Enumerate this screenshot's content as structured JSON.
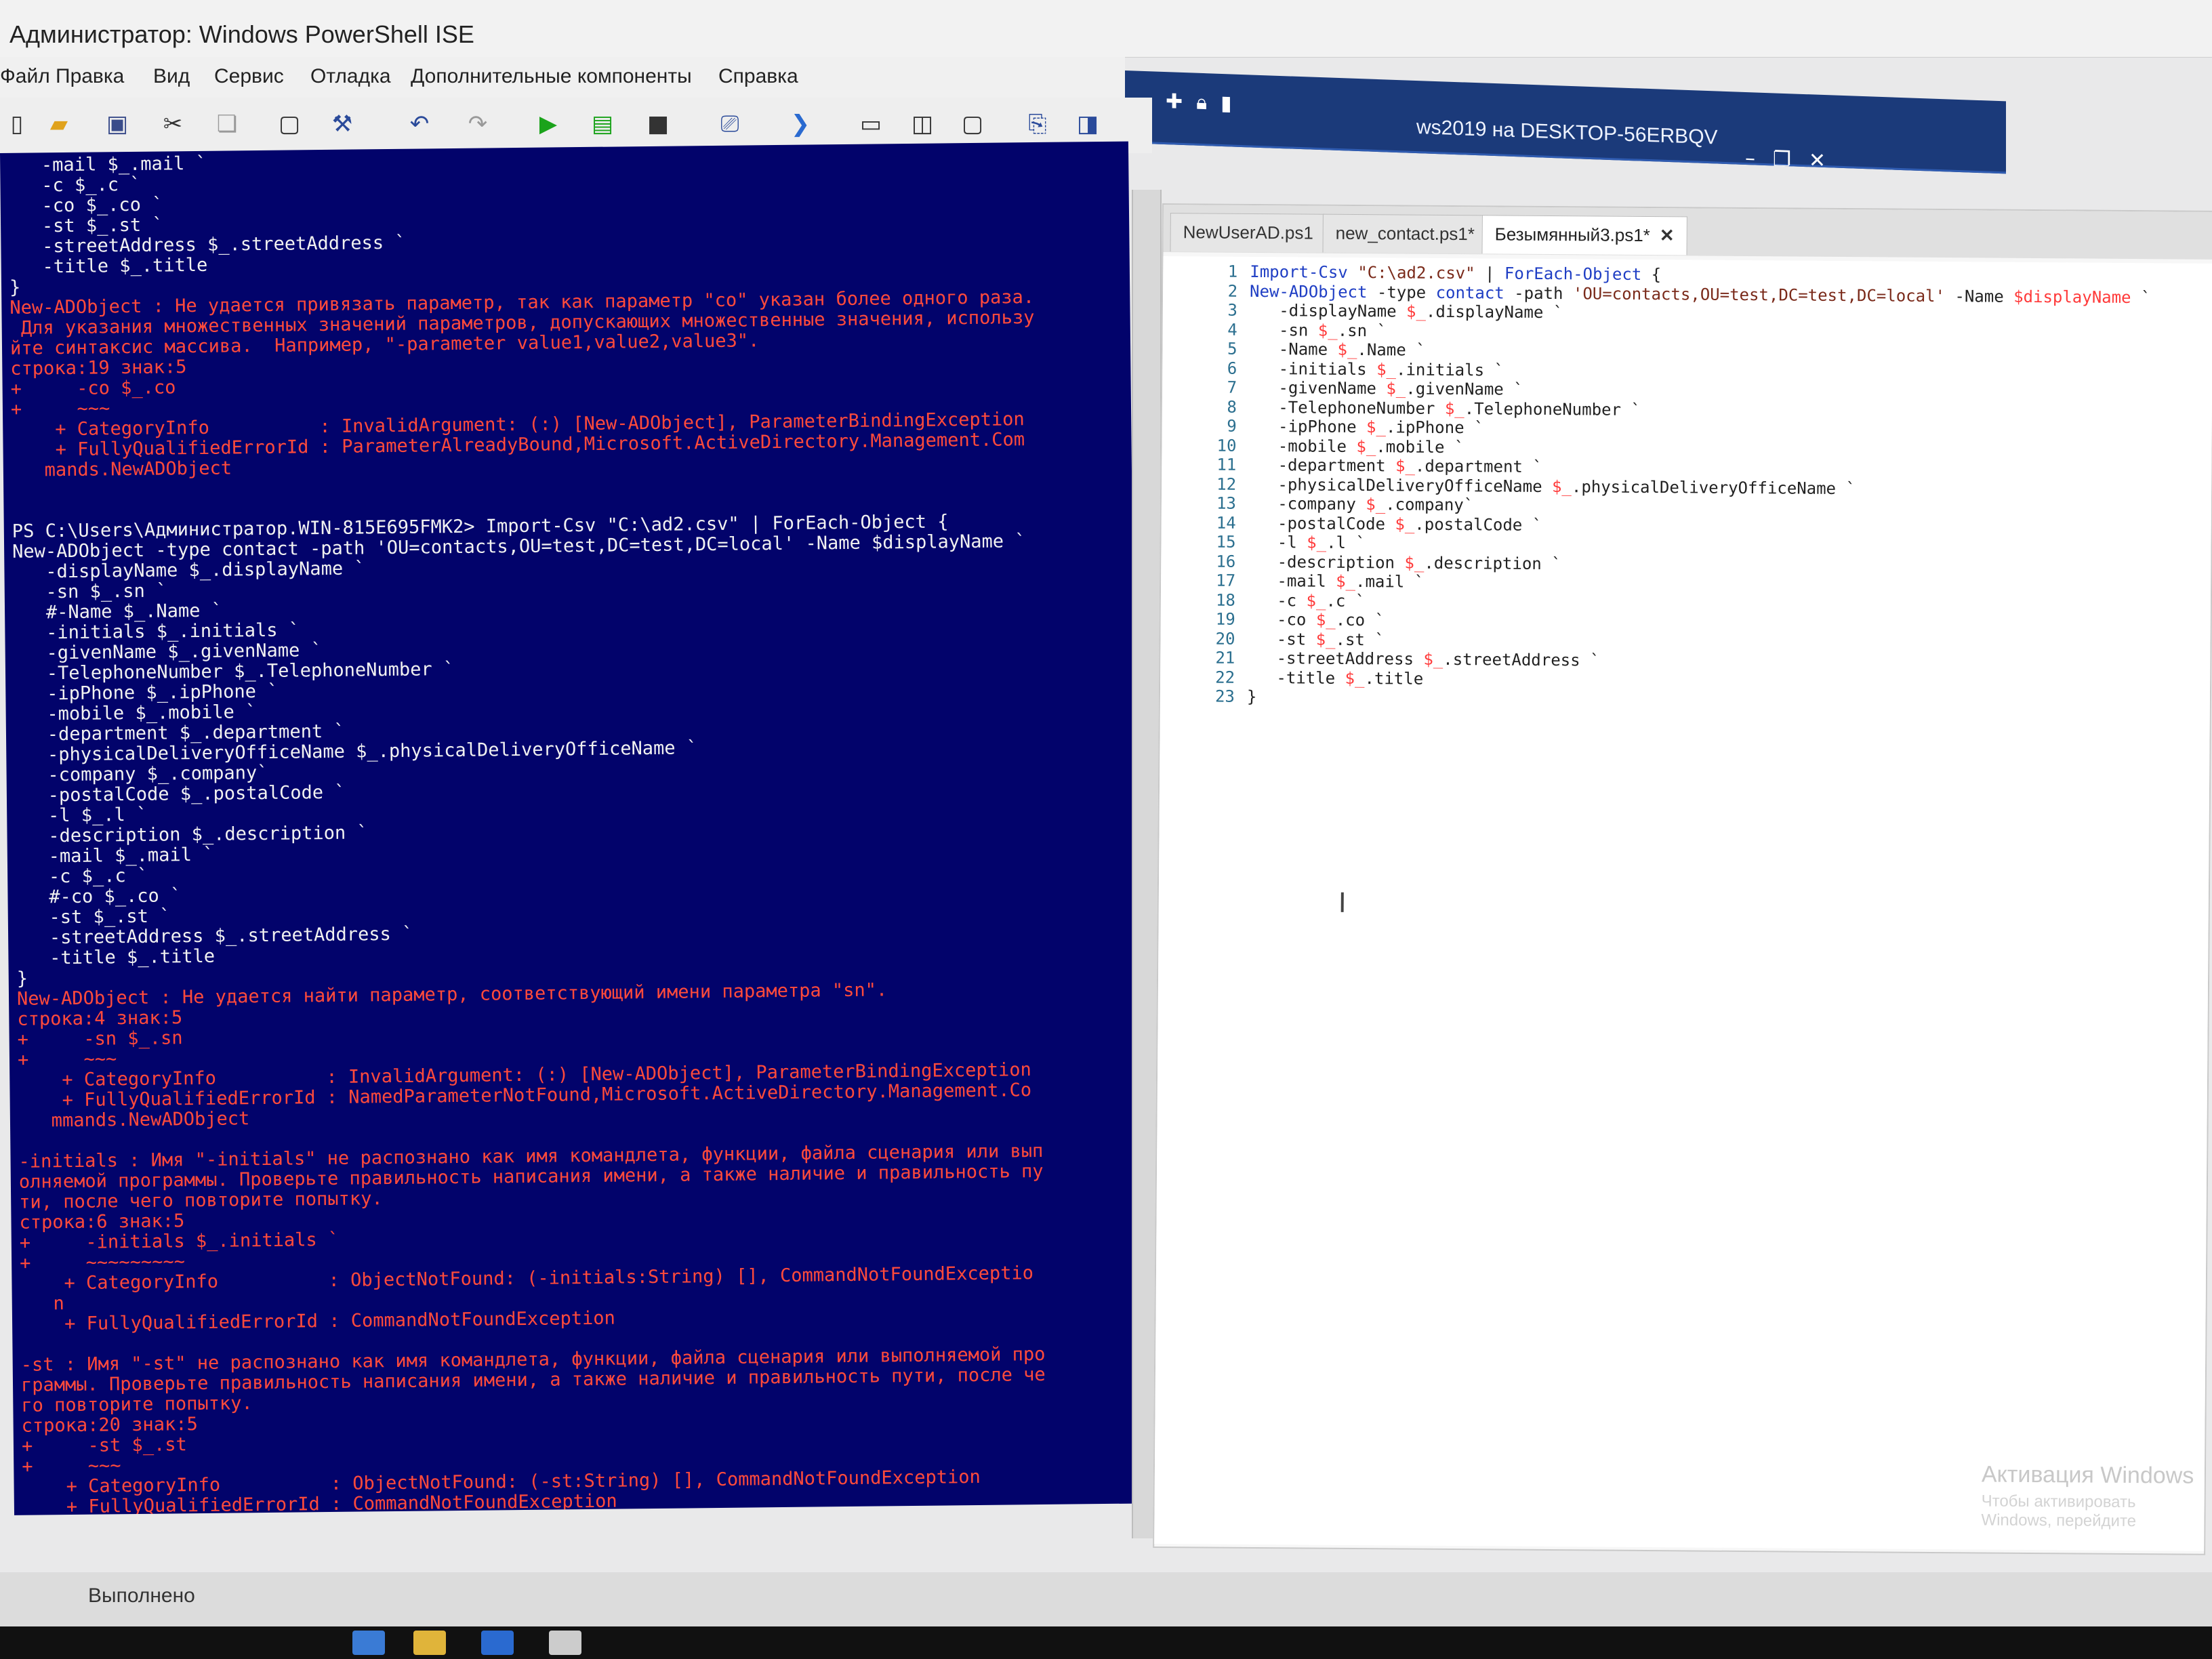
{
  "window": {
    "title": "Администратор: Windows PowerShell ISE",
    "status": "Выполнено"
  },
  "menu": {
    "items": [
      "Файл",
      "Правка",
      "Вид",
      "Сервис",
      "Отладка",
      "Дополнительные компоненты",
      "Справка"
    ]
  },
  "remote": {
    "title": "ws2019 на DESKTOP-56ERBQV",
    "icons": [
      "pin-icon",
      "lock-icon",
      "signal-icon"
    ],
    "window_buttons": [
      "minimize-icon",
      "restore-icon",
      "close-icon"
    ]
  },
  "toolbar": {
    "buttons": [
      "new-icon",
      "open-icon",
      "save-icon",
      "cut-icon",
      "copy-icon",
      "paste-icon",
      "clear-icon",
      "undo-icon",
      "redo-icon",
      "run-icon",
      "run-selection-icon",
      "stop-icon",
      "remote-tab-icon",
      "powershell-icon",
      "layout-top-icon",
      "layout-right-icon",
      "layout-max-icon",
      "commands-icon",
      "addon-icon"
    ]
  },
  "console": {
    "lines": [
      {
        "t": "   -mail $_.mail `",
        "c": "white"
      },
      {
        "t": "   -c $_.c `",
        "c": "white"
      },
      {
        "t": "   -co $_.co `",
        "c": "white"
      },
      {
        "t": "   -st $_.st `",
        "c": "white"
      },
      {
        "t": "   -streetAddress $_.streetAddress `",
        "c": "white"
      },
      {
        "t": "   -title $_.title",
        "c": "white"
      },
      {
        "t": "}",
        "c": "white"
      },
      {
        "t": "New-ADObject : Не удается привязать параметр, так как параметр \"co\" указан более одного раза.",
        "c": "red"
      },
      {
        "t": " Для указания множественных значений параметров, допускающих множественные значения, использу",
        "c": "red"
      },
      {
        "t": "йте синтаксис массива.  Например, \"-parameter value1,value2,value3\".",
        "c": "red"
      },
      {
        "t": "строка:19 знак:5",
        "c": "red"
      },
      {
        "t": "+     -co $_.co",
        "c": "red"
      },
      {
        "t": "+     ~~~",
        "c": "red"
      },
      {
        "t": "    + CategoryInfo          : InvalidArgument: (:) [New-ADObject], ParameterBindingException",
        "c": "red"
      },
      {
        "t": "    + FullyQualifiedErrorId : ParameterAlreadyBound,Microsoft.ActiveDirectory.Management.Com",
        "c": "red"
      },
      {
        "t": "   mands.NewADObject",
        "c": "red"
      },
      {
        "t": "",
        "c": "white"
      },
      {
        "t": "",
        "c": "white"
      },
      {
        "t": "PS C:\\Users\\Администратор.WIN-815E695FMK2> Import-Csv \"C:\\ad2.csv\" | ForEach-Object {",
        "c": "white"
      },
      {
        "t": "New-ADObject -type contact -path 'OU=contacts,OU=test,DC=test,DC=local' -Name $displayName `",
        "c": "white"
      },
      {
        "t": "   -displayName $_.displayName `",
        "c": "white"
      },
      {
        "t": "   -sn $_.sn `",
        "c": "white"
      },
      {
        "t": "   #-Name $_.Name `",
        "c": "white"
      },
      {
        "t": "   -initials $_.initials `",
        "c": "white"
      },
      {
        "t": "   -givenName $_.givenName `",
        "c": "white"
      },
      {
        "t": "   -TelephoneNumber $_.TelephoneNumber `",
        "c": "white"
      },
      {
        "t": "   -ipPhone $_.ipPhone `",
        "c": "white"
      },
      {
        "t": "   -mobile $_.mobile `",
        "c": "white"
      },
      {
        "t": "   -department $_.department `",
        "c": "white"
      },
      {
        "t": "   -physicalDeliveryOfficeName $_.physicalDeliveryOfficeName `",
        "c": "white"
      },
      {
        "t": "   -company $_.company`",
        "c": "white"
      },
      {
        "t": "   -postalCode $_.postalCode `",
        "c": "white"
      },
      {
        "t": "   -l $_.l `",
        "c": "white"
      },
      {
        "t": "   -description $_.description `",
        "c": "white"
      },
      {
        "t": "   -mail $_.mail `",
        "c": "white"
      },
      {
        "t": "   -c $_.c `",
        "c": "white"
      },
      {
        "t": "   #-co $_.co `",
        "c": "white"
      },
      {
        "t": "   -st $_.st `",
        "c": "white"
      },
      {
        "t": "   -streetAddress $_.streetAddress `",
        "c": "white"
      },
      {
        "t": "   -title $_.title",
        "c": "white"
      },
      {
        "t": "}",
        "c": "white"
      },
      {
        "t": "New-ADObject : Не удается найти параметр, соответствующий имени параметра \"sn\".",
        "c": "red"
      },
      {
        "t": "строка:4 знак:5",
        "c": "red"
      },
      {
        "t": "+     -sn $_.sn",
        "c": "red"
      },
      {
        "t": "+     ~~~",
        "c": "red"
      },
      {
        "t": "    + CategoryInfo          : InvalidArgument: (:) [New-ADObject], ParameterBindingException",
        "c": "red"
      },
      {
        "t": "    + FullyQualifiedErrorId : NamedParameterNotFound,Microsoft.ActiveDirectory.Management.Co",
        "c": "red"
      },
      {
        "t": "   mmands.NewADObject",
        "c": "red"
      },
      {
        "t": "",
        "c": "white"
      },
      {
        "t": "-initials : Имя \"-initials\" не распознано как имя командлета, функции, файла сценария или вып",
        "c": "red"
      },
      {
        "t": "олняемой программы. Проверьте правильность написания имени, а также наличие и правильность пу",
        "c": "red"
      },
      {
        "t": "ти, после чего повторите попытку.",
        "c": "red"
      },
      {
        "t": "строка:6 знак:5",
        "c": "red"
      },
      {
        "t": "+     -initials $_.initials `",
        "c": "red"
      },
      {
        "t": "+     ~~~~~~~~~",
        "c": "red"
      },
      {
        "t": "    + CategoryInfo          : ObjectNotFound: (-initials:String) [], CommandNotFoundExceptio",
        "c": "red"
      },
      {
        "t": "   n",
        "c": "red"
      },
      {
        "t": "    + FullyQualifiedErrorId : CommandNotFoundException",
        "c": "red"
      },
      {
        "t": "",
        "c": "white"
      },
      {
        "t": "-st : Имя \"-st\" не распознано как имя командлета, функции, файла сценария или выполняемой про",
        "c": "red"
      },
      {
        "t": "граммы. Проверьте правильность написания имени, а также наличие и правильность пути, после че",
        "c": "red"
      },
      {
        "t": "го повторите попытку.",
        "c": "red"
      },
      {
        "t": "строка:20 знак:5",
        "c": "red"
      },
      {
        "t": "+     -st $_.st",
        "c": "red"
      },
      {
        "t": "+     ~~~",
        "c": "red"
      },
      {
        "t": "    + CategoryInfo          : ObjectNotFound: (-st:String) [], CommandNotFoundException",
        "c": "red"
      },
      {
        "t": "    + FullyQualifiedErrorId : CommandNotFoundException",
        "c": "red"
      },
      {
        "t": "",
        "c": "white"
      },
      {
        "t": "",
        "c": "white"
      },
      {
        "t": "PS C:\\Users\\Администратор.WIN-815E695FMK2>",
        "c": "white"
      }
    ]
  },
  "editor": {
    "tabs": [
      {
        "label": "NewUserAD.ps1",
        "active": false
      },
      {
        "label": "new_contact.ps1*",
        "active": false
      },
      {
        "label": "Безымянный3.ps1*",
        "active": true
      }
    ],
    "code": [
      "Import-Csv \"C:\\ad2.csv\" | ForEach-Object {",
      "New-ADObject -type contact -path 'OU=contacts,OU=test,DC=test,DC=local' -Name $displayName `",
      "   -displayName $_.displayName `",
      "   -sn $_.sn `",
      "   -Name $_.Name `",
      "   -initials $_.initials `",
      "   -givenName $_.givenName `",
      "   -TelephoneNumber $_.TelephoneNumber `",
      "   -ipPhone $_.ipPhone `",
      "   -mobile $_.mobile `",
      "   -department $_.department `",
      "   -physicalDeliveryOfficeName $_.physicalDeliveryOfficeName `",
      "   -company $_.company`",
      "   -postalCode $_.postalCode `",
      "   -l $_.l `",
      "   -description $_.description `",
      "   -mail $_.mail `",
      "   -c $_.c `",
      "   -co $_.co `",
      "   -st $_.st `",
      "   -streetAddress $_.streetAddress `",
      "   -title $_.title",
      "}"
    ],
    "watermark": "Активация Windows",
    "watermark_sub": "Чтобы активировать Windows, перейдите"
  },
  "colors": {
    "console_bg": "#02036b",
    "console_text": "#f1f1f1",
    "console_error": "#ff4a3b",
    "remote_bar": "#1b3a7a"
  }
}
